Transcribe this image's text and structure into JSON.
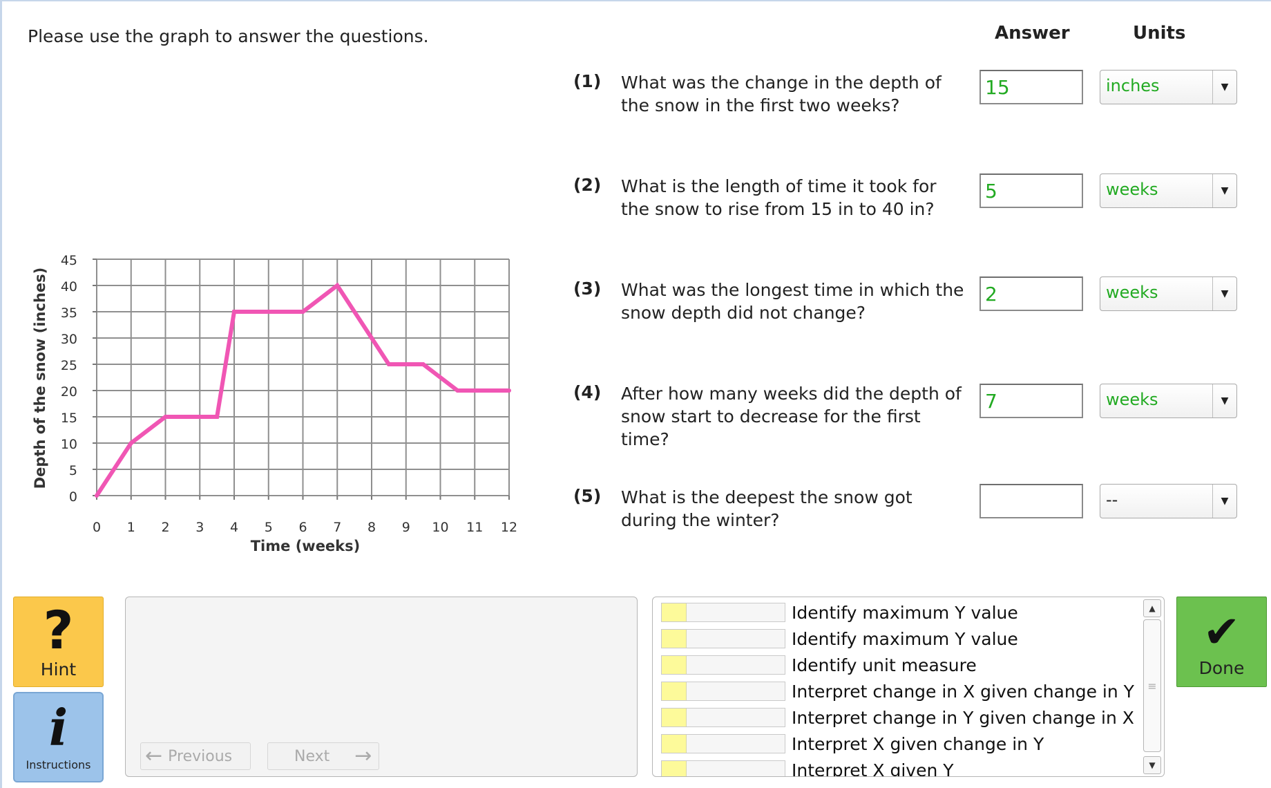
{
  "header": {
    "instructions": "Please use the graph to answer the questions.",
    "answer_col": "Answer",
    "units_col": "Units"
  },
  "questions": [
    {
      "num": "(1)",
      "text": "What was the change in the depth of the snow in the first two weeks?",
      "answer": "15",
      "unit": "inches"
    },
    {
      "num": "(2)",
      "text": "What is the length of time it took for the snow to rise from 15 in to 40 in?",
      "answer": "5",
      "unit": "weeks"
    },
    {
      "num": "(3)",
      "text": "What was the longest time in which the snow depth did not change?",
      "answer": "2",
      "unit": "weeks"
    },
    {
      "num": "(4)",
      "text": "After how many weeks did the depth of snow start to decrease for the first time?",
      "answer": "7",
      "unit": "weeks"
    },
    {
      "num": "(5)",
      "text": "What is the deepest the snow got during the winter?",
      "answer": "",
      "unit": "--"
    }
  ],
  "chart_data": {
    "type": "line",
    "xlabel": "Time (weeks)",
    "ylabel": "Depth of the snow (inches)",
    "xlim": [
      0,
      12
    ],
    "ylim": [
      0,
      45
    ],
    "xticks": [
      "0",
      "1",
      "2",
      "3",
      "4",
      "5",
      "6",
      "7",
      "8",
      "9",
      "10",
      "11",
      "12"
    ],
    "yticks": [
      "0",
      "5",
      "10",
      "15",
      "20",
      "25",
      "30",
      "35",
      "40",
      "45"
    ],
    "grid": true,
    "line_color": "#f056b4",
    "x": [
      0,
      1,
      2,
      3.5,
      4,
      6,
      7,
      8,
      8.5,
      9.5,
      10.5,
      12
    ],
    "y": [
      0,
      10,
      15,
      15,
      35,
      35,
      40,
      30,
      25,
      25,
      20,
      20
    ]
  },
  "hint": {
    "label": "Hint",
    "icon": "question-mark-icon",
    "color": "#fbc84b"
  },
  "instructions_btn": {
    "label": "Instructions",
    "icon": "info-icon",
    "color": "#9cc3ea"
  },
  "nav": {
    "previous": "Previous",
    "next": "Next"
  },
  "skills": [
    {
      "label": "Identify maximum Y value",
      "progress": 0.2
    },
    {
      "label": "Identify maximum Y value",
      "progress": 0.2
    },
    {
      "label": "Identify unit measure",
      "progress": 0.2
    },
    {
      "label": "Interpret change in X given change in Y",
      "progress": 0.2
    },
    {
      "label": "Interpret change in Y given change in X",
      "progress": 0.2
    },
    {
      "label": "Interpret X given change in Y",
      "progress": 0.2
    },
    {
      "label": "Interpret X given Y",
      "progress": 0.2
    }
  ],
  "done": {
    "label": "Done",
    "icon": "checkmark-icon",
    "color": "#6cc14f"
  }
}
